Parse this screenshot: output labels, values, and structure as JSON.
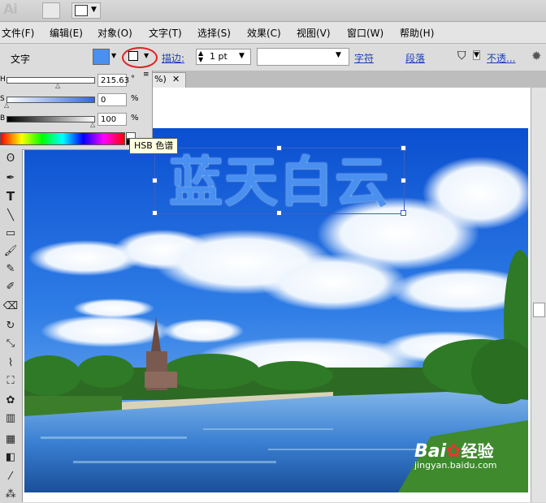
{
  "app": {
    "logo": "Ai"
  },
  "menu": [
    "文件(F)",
    "编辑(E)",
    "对象(O)",
    "文字(T)",
    "选择(S)",
    "效果(C)",
    "视图(V)",
    "窗口(W)",
    "帮助(H)"
  ],
  "control_bar": {
    "tool_label": "文字",
    "fill_color": "#4a90f0",
    "stroke_label": "描边:",
    "stroke_weight": "1 pt",
    "char_link": "字符",
    "para_link": "段落",
    "opacity_link": "不透..."
  },
  "color_panel": {
    "h_label": "H",
    "h_value": "215.63",
    "h_unit": "°",
    "s_label": "S",
    "s_value": "0",
    "s_unit": "%",
    "b_label": "B",
    "b_value": "100",
    "b_unit": "%"
  },
  "tooltip": "HSB 色谱",
  "artwork": {
    "title_text": "蓝天白云",
    "title_color": "#4a90f0"
  },
  "watermark": {
    "brand": "Bai",
    "brand_suffix": "经验",
    "url": "jingyan.baidu.com"
  },
  "tools": [
    "direct-select",
    "pen",
    "type",
    "line",
    "rectangle",
    "paintbrush",
    "pencil",
    "blob-brush",
    "eraser",
    "rotate",
    "scale",
    "warp",
    "free-transform",
    "symbol-sprayer",
    "column-graph",
    "mesh",
    "gradient",
    "eyedropper",
    "blend"
  ]
}
